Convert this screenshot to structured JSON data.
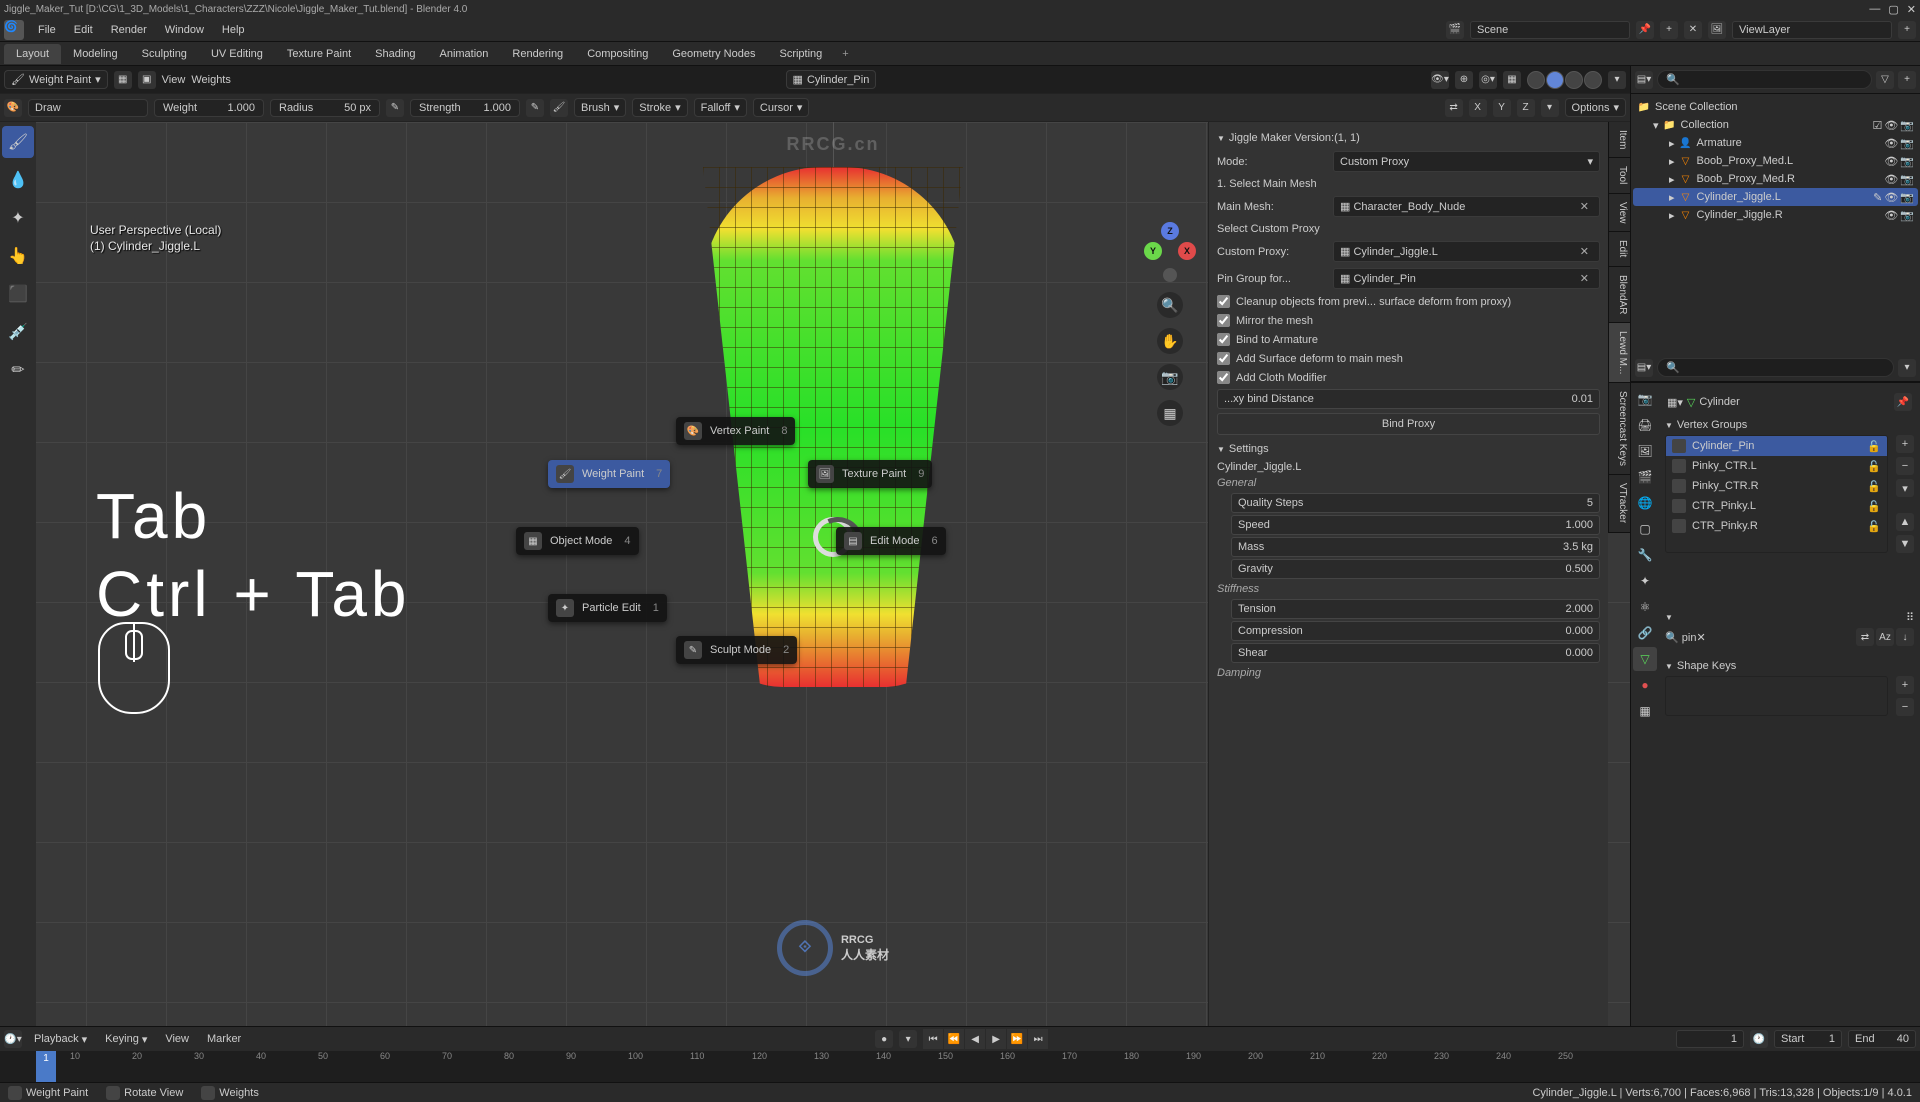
{
  "titlebar": {
    "path": "Jiggle_Maker_Tut [D:\\CG\\1_3D_Models\\1_Characters\\ZZZ\\Nicole\\Jiggle_Maker_Tut.blend] - Blender 4.0",
    "min": "—",
    "max": "▢",
    "close": "✕"
  },
  "menu": {
    "items": [
      "File",
      "Edit",
      "Render",
      "Window",
      "Help"
    ]
  },
  "workspaces": {
    "tabs": [
      "Layout",
      "Modeling",
      "Sculpting",
      "UV Editing",
      "Texture Paint",
      "Shading",
      "Animation",
      "Rendering",
      "Compositing",
      "Geometry Nodes",
      "Scripting"
    ],
    "active": 0,
    "plus": "+"
  },
  "scene": {
    "label": "Scene",
    "viewlayer": "ViewLayer"
  },
  "vpheader": {
    "mode": "Weight Paint",
    "vgroup": "Cylinder_Pin",
    "menus": [
      "View",
      "Weights"
    ]
  },
  "brushbar": {
    "tool": "Draw",
    "weight_l": "Weight",
    "weight_v": "1.000",
    "radius_l": "Radius",
    "radius_v": "50 px",
    "strength_l": "Strength",
    "strength_v": "1.000",
    "brush": "Brush",
    "stroke": "Stroke",
    "falloff": "Falloff",
    "cursor": "Cursor",
    "mirror": [
      "X",
      "Y",
      "Z"
    ],
    "options": "Options"
  },
  "vpoverlay": {
    "line1": "User Perspective (Local)",
    "line2": "(1) Cylinder_Jiggle.L"
  },
  "bigkeys": {
    "l1": "Tab",
    "l2": "Ctrl + Tab"
  },
  "pie": {
    "vertex": {
      "label": "Vertex Paint",
      "key": "8"
    },
    "weight": {
      "label": "Weight Paint",
      "key": "7"
    },
    "texture": {
      "label": "Texture Paint",
      "key": "9"
    },
    "object": {
      "label": "Object Mode",
      "key": "4"
    },
    "edit": {
      "label": "Edit Mode",
      "key": "6"
    },
    "particle": {
      "label": "Particle Edit",
      "key": "1"
    },
    "sculpt": {
      "label": "Sculpt Mode",
      "key": "2"
    }
  },
  "rtabs": [
    "Item",
    "Tool",
    "View",
    "Edit",
    "BlendAR",
    "Lewd M...",
    "Screencast Keys",
    "VTracker"
  ],
  "jiggle": {
    "title": "Jiggle Maker Version:(1, 1)",
    "mode_l": "Mode:",
    "mode_v": "Custom Proxy",
    "step1": "1. Select Main Mesh",
    "mainmesh_l": "Main Mesh:",
    "mainmesh_v": "Character_Body_Nude",
    "selcp": "Select Custom Proxy",
    "cp_l": "Custom Proxy:",
    "cp_v": "Cylinder_Jiggle.L",
    "pin_l": "Pin Group for...",
    "pin_v": "Cylinder_Pin",
    "c1": "Cleanup objects from previ... surface deform from proxy)",
    "c2": "Mirror the mesh",
    "c3": "Bind to Armature",
    "c4": "Add Surface deform to main mesh",
    "c5": "Add Cloth Modifier",
    "dist_l": "...xy bind Distance",
    "dist_v": "0.01",
    "bind": "Bind Proxy",
    "settings": "Settings",
    "active": "Cylinder_Jiggle.L",
    "general": "General",
    "qs_l": "Quality Steps",
    "qs_v": "5",
    "speed_l": "Speed",
    "speed_v": "1.000",
    "mass_l": "Mass",
    "mass_v": "3.5 kg",
    "grav_l": "Gravity",
    "grav_v": "0.500",
    "stiff": "Stiffness",
    "ten_l": "Tension",
    "ten_v": "2.000",
    "comp_l": "Compression",
    "comp_v": "0.000",
    "shear_l": "Shear",
    "shear_v": "0.000",
    "damp": "Damping"
  },
  "outliner": {
    "title": "Scene Collection",
    "items": [
      {
        "name": "Collection",
        "depth": 1
      },
      {
        "name": "Armature",
        "depth": 2
      },
      {
        "name": "Boob_Proxy_Med.L",
        "depth": 2
      },
      {
        "name": "Boob_Proxy_Med.R",
        "depth": 2
      },
      {
        "name": "Cylinder_Jiggle.L",
        "depth": 2,
        "sel": true
      },
      {
        "name": "Cylinder_Jiggle.R",
        "depth": 2
      }
    ],
    "search_ph": "Search"
  },
  "props": {
    "object": "Cylinder",
    "vg_title": "Vertex Groups",
    "groups": [
      {
        "name": "Cylinder_Pin",
        "sel": true
      },
      {
        "name": "Pinky_CTR.L"
      },
      {
        "name": "Pinky_CTR.R"
      },
      {
        "name": "CTR_Pinky.L"
      },
      {
        "name": "CTR_Pinky.R"
      }
    ],
    "filter": "pin",
    "sk_title": "Shape Keys"
  },
  "timeline": {
    "menus": [
      "Playback",
      "Keying",
      "View",
      "Marker"
    ],
    "frame": "1",
    "start_l": "Start",
    "start_v": "1",
    "end_l": "End",
    "end_v": "40",
    "ticks": [
      "10",
      "20",
      "30",
      "40",
      "50",
      "60",
      "70",
      "80",
      "90",
      "100",
      "110",
      "120",
      "130",
      "140",
      "150",
      "160",
      "170",
      "180",
      "190",
      "200",
      "210",
      "220",
      "230",
      "240",
      "250"
    ],
    "cursor": "1"
  },
  "status": {
    "a": "Weight Paint",
    "b": "Rotate View",
    "c": "Weights",
    "stats": "Cylinder_Jiggle.L  |  Verts:6,700  |  Faces:6,968  |  Tris:13,328  |  Objects:1/9  |  4.0.1"
  },
  "watermark": {
    "top": "RRCG.cn",
    "bottom": "RRCG",
    "bottom2": "人人素材"
  }
}
